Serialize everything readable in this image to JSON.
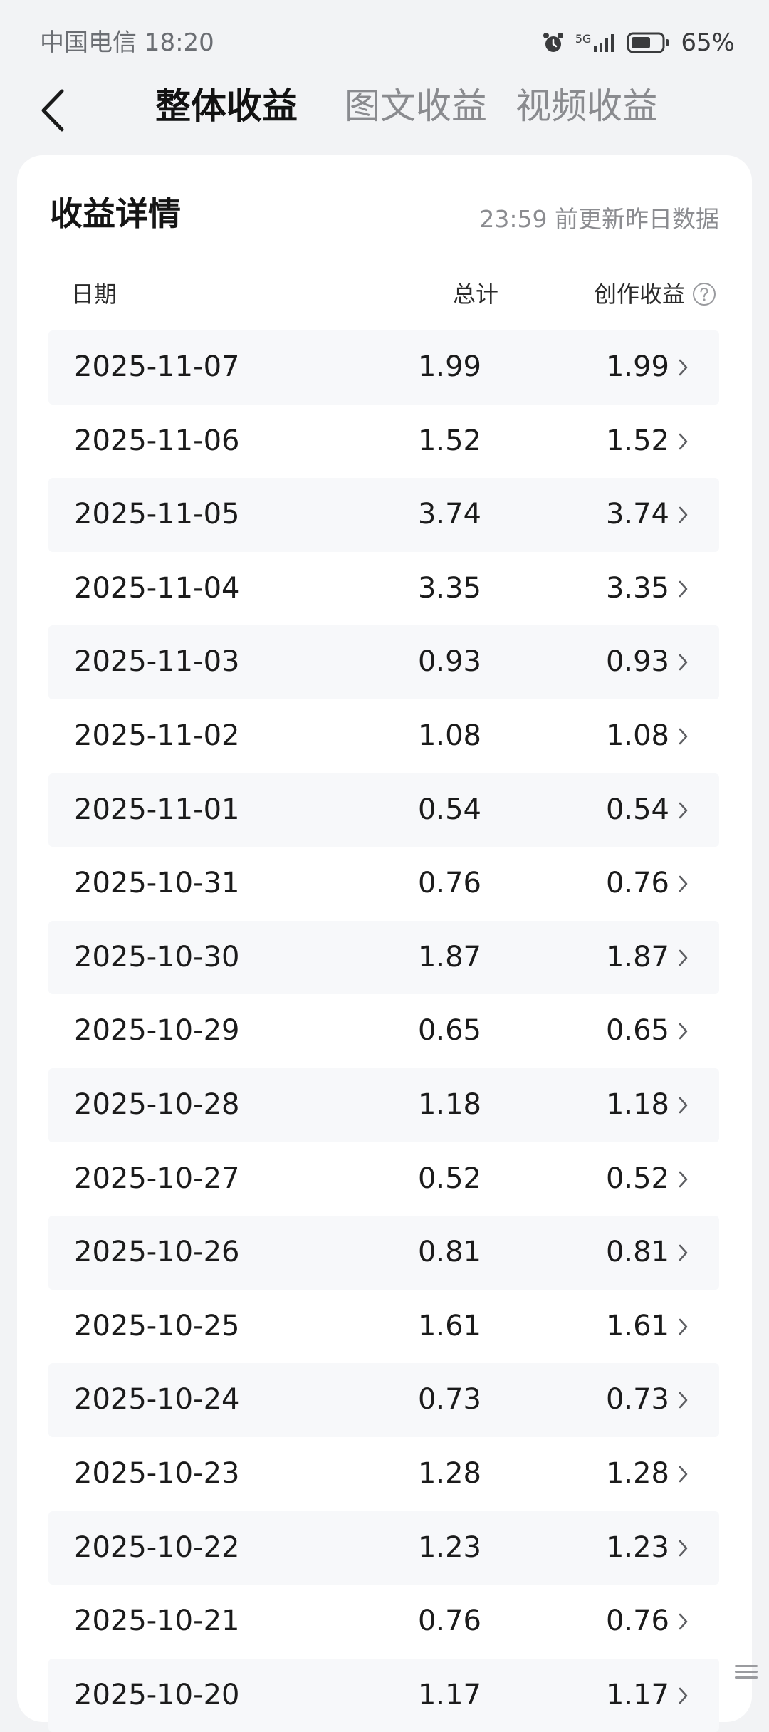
{
  "status_bar": {
    "carrier_time": "中国电信 18:20",
    "network": "5G",
    "battery": "65%",
    "battery_level": 0.65
  },
  "header": {
    "tabs": [
      {
        "label": "整体收益",
        "active": true
      },
      {
        "label": "图文收益",
        "active": false
      },
      {
        "label": "视频收益",
        "active": false
      }
    ]
  },
  "card": {
    "title": "收益详情",
    "update_note": "23:59 前更新昨日数据",
    "columns": {
      "date": "日期",
      "total": "总计",
      "creation": "创作收益"
    }
  },
  "rows": [
    {
      "date": "2025-11-07",
      "total": "1.99",
      "creation": "1.99"
    },
    {
      "date": "2025-11-06",
      "total": "1.52",
      "creation": "1.52"
    },
    {
      "date": "2025-11-05",
      "total": "3.74",
      "creation": "3.74"
    },
    {
      "date": "2025-11-04",
      "total": "3.35",
      "creation": "3.35"
    },
    {
      "date": "2025-11-03",
      "total": "0.93",
      "creation": "0.93"
    },
    {
      "date": "2025-11-02",
      "total": "1.08",
      "creation": "1.08"
    },
    {
      "date": "2025-11-01",
      "total": "0.54",
      "creation": "0.54"
    },
    {
      "date": "2025-10-31",
      "total": "0.76",
      "creation": "0.76"
    },
    {
      "date": "2025-10-30",
      "total": "1.87",
      "creation": "1.87"
    },
    {
      "date": "2025-10-29",
      "total": "0.65",
      "creation": "0.65"
    },
    {
      "date": "2025-10-28",
      "total": "1.18",
      "creation": "1.18"
    },
    {
      "date": "2025-10-27",
      "total": "0.52",
      "creation": "0.52"
    },
    {
      "date": "2025-10-26",
      "total": "0.81",
      "creation": "0.81"
    },
    {
      "date": "2025-10-25",
      "total": "1.61",
      "creation": "1.61"
    },
    {
      "date": "2025-10-24",
      "total": "0.73",
      "creation": "0.73"
    },
    {
      "date": "2025-10-23",
      "total": "1.28",
      "creation": "1.28"
    },
    {
      "date": "2025-10-22",
      "total": "1.23",
      "creation": "1.23"
    },
    {
      "date": "2025-10-21",
      "total": "0.76",
      "creation": "0.76"
    },
    {
      "date": "2025-10-20",
      "total": "1.17",
      "creation": "1.17"
    }
  ],
  "colors": {
    "background": "#f2f3f5",
    "card": "#ffffff",
    "row_shade": "#f7f8fa",
    "active_tab": "#121212",
    "inactive_tab": "#8a8b8f"
  },
  "icons": [
    "back-arrow-icon",
    "alarm-icon",
    "signal-icon",
    "battery-icon",
    "help-icon",
    "chevron-right-icon",
    "scroll-handle-icon"
  ]
}
